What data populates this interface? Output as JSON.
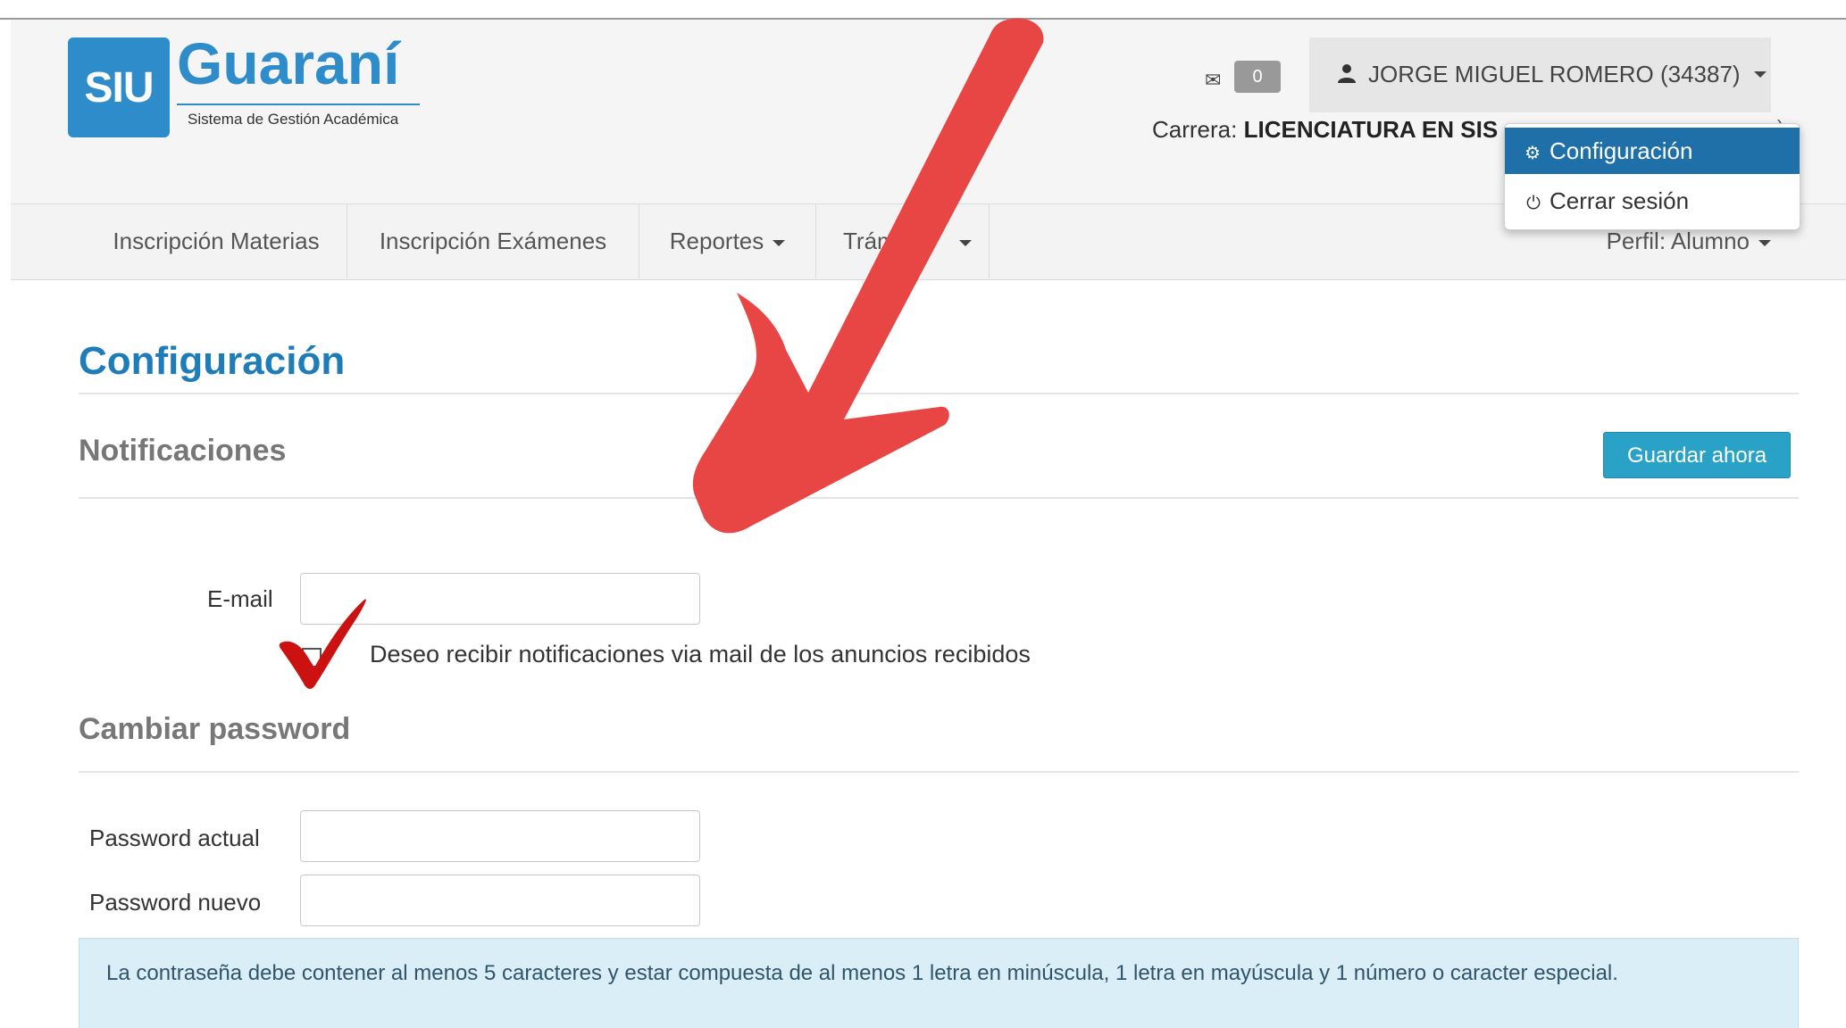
{
  "logo": {
    "badge": "SIU",
    "name": "Guaraní",
    "subtitle": "Sistema de Gestión Académica"
  },
  "header": {
    "messages_count": "0",
    "user_name": "JORGE MIGUEL ROMERO (34387)",
    "carrera_label": "Carrera:",
    "carrera_value": "LICENCIATURA EN SIS",
    "carrera_tail": ")"
  },
  "user_menu": {
    "items": [
      {
        "label": "Configuración",
        "icon": "gear-icon",
        "active": true
      },
      {
        "label": "Cerrar sesión",
        "icon": "power-icon",
        "active": false
      }
    ]
  },
  "nav": {
    "items": [
      {
        "label": "Inscripción Materias"
      },
      {
        "label": "Inscripción Exámenes"
      },
      {
        "label": "Reportes"
      },
      {
        "label": "Trám"
      }
    ],
    "perfil": "Perfil: Alumno"
  },
  "page": {
    "title": "Configuración"
  },
  "notifications": {
    "title": "Notificaciones",
    "save_label": "Guardar ahora",
    "email_label": "E-mail",
    "email_value": "",
    "checkbox_label": "Deseo recibir notificaciones via mail de los anuncios recibidos",
    "checkbox_checked": false
  },
  "password": {
    "title": "Cambiar password",
    "current_label": "Password actual",
    "new_label": "Password nuevo",
    "info": "La contraseña debe contener al menos 5 caracteres y estar compuesta de al menos 1 letra en minúscula, 1 letra en mayúscula y 1 número o caracter especial."
  },
  "colors": {
    "brand": "#2e8ccb",
    "title": "#1e7cb8",
    "button": "#2aa2c8",
    "annotation": "#e84545",
    "checkmark": "#cc1111",
    "info_bg": "#d9eef7"
  }
}
